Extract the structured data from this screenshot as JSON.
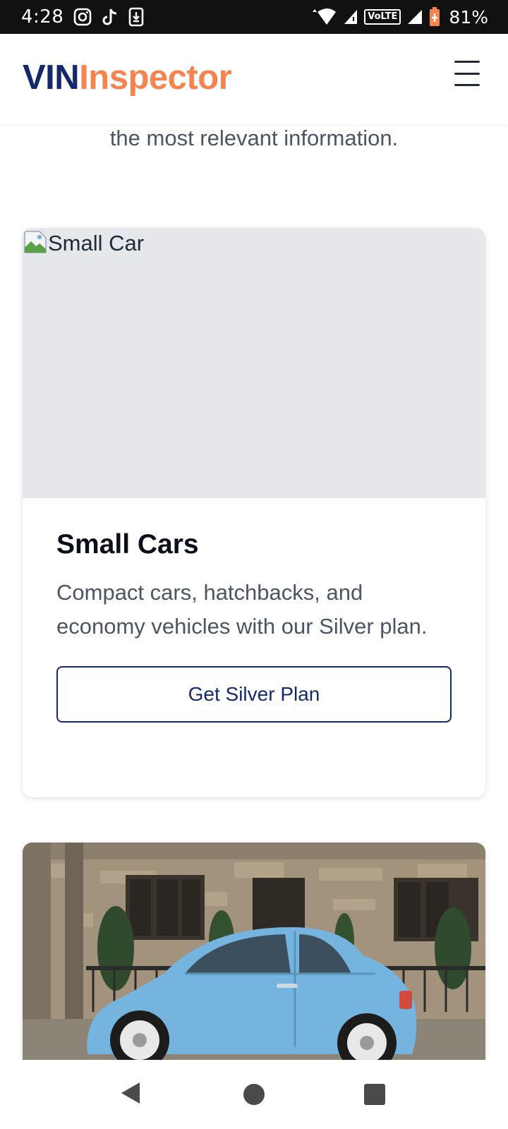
{
  "status_bar": {
    "time": "4:28",
    "network": "VoLTE",
    "battery": "81%"
  },
  "header": {
    "logo_part1": "VIN",
    "logo_part2": "Inspector",
    "menu_icon": "hamburger-menu-icon"
  },
  "intro": {
    "text": "the most relevant information."
  },
  "cards": [
    {
      "image_alt": "Small Car",
      "title": "Small Cars",
      "description": "Compact cars, hatchbacks, and economy vehicles with our Silver plan.",
      "button": "Get Silver Plan"
    },
    {
      "image": "light blue compact car parked in front of a stone building"
    }
  ],
  "colors": {
    "brand_navy": "#13296b",
    "brand_orange": "#f7834f",
    "placeholder_gray": "#e5e7eb",
    "text_gray": "#4b5563"
  },
  "nav_bar": {
    "icons": [
      "back-icon",
      "home-icon",
      "recents-icon"
    ]
  }
}
